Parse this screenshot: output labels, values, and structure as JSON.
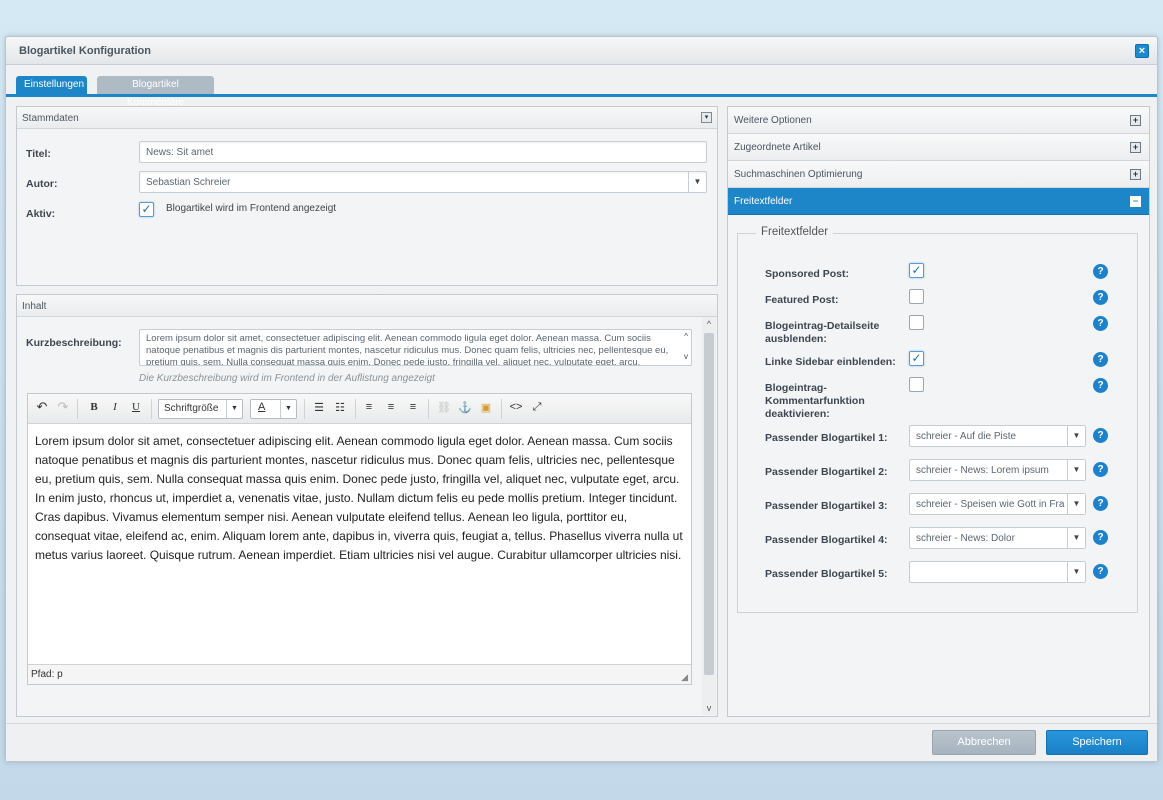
{
  "window": {
    "title": "Blogartikel Konfiguration",
    "close_icon": "×"
  },
  "tabs": [
    {
      "label": "Einstellungen",
      "active": true
    },
    {
      "label": "Blogartikel Kommentare",
      "active": false
    }
  ],
  "stammdaten": {
    "title": "Stammdaten",
    "titel_label": "Titel:",
    "titel_value": "News: Sit amet",
    "autor_label": "Autor:",
    "autor_value": "Sebastian Schreier",
    "aktiv_label": "Aktiv:",
    "aktiv_checked": true,
    "aktiv_text": "Blogartikel wird im Frontend angezeigt"
  },
  "inhalt": {
    "title": "Inhalt",
    "kurz_label": "Kurzbeschreibung:",
    "kurz_value": "Lorem ipsum dolor sit amet, consectetuer adipiscing elit. Aenean commodo ligula eget dolor. Aenean massa. Cum sociis natoque penatibus et magnis dis parturient montes, nascetur ridiculus mus. Donec quam felis, ultricies nec, pellentesque eu, pretium quis, sem. Nulla consequat massa quis enim. Donec pede justo, fringilla vel, aliquet nec, vulputate eget, arcu.",
    "kurz_hint": "Die Kurzbeschreibung wird im Frontend in der Auflistung angezeigt",
    "editor": {
      "fontsize_label": "Schriftgröße",
      "color_label": "A",
      "body": "Lorem ipsum dolor sit amet, consectetuer adipiscing elit. Aenean commodo ligula eget dolor. Aenean massa. Cum sociis natoque penatibus et magnis dis parturient montes, nascetur ridiculus mus. Donec quam felis, ultricies nec, pellentesque eu, pretium quis, sem. Nulla consequat massa quis enim. Donec pede justo, fringilla vel, aliquet nec, vulputate eget, arcu. In enim justo, rhoncus ut, imperdiet a, venenatis vitae, justo. Nullam dictum felis eu pede mollis pretium. Integer tincidunt. Cras dapibus. Vivamus elementum semper nisi. Aenean vulputate eleifend tellus. Aenean leo ligula, porttitor eu, consequat vitae, eleifend ac, enim. Aliquam lorem ante, dapibus in, viverra quis, feugiat a, tellus. Phasellus viverra nulla ut metus varius laoreet. Quisque rutrum. Aenean imperdiet. Etiam ultricies nisi vel augue. Curabitur ullamcorper ultricies nisi.",
      "path_label": "Pfad:",
      "path_value": "p"
    }
  },
  "accordion": [
    {
      "label": "Weitere Optionen",
      "active": false
    },
    {
      "label": "Zugeordnete Artikel",
      "active": false
    },
    {
      "label": "Suchmaschinen Optimierung",
      "active": false
    },
    {
      "label": "Freitextfelder",
      "active": true
    }
  ],
  "freitext": {
    "legend": "Freitextfelder",
    "checkboxes": [
      {
        "label": "Sponsored Post:",
        "checked": true
      },
      {
        "label": "Featured Post:",
        "checked": false
      },
      {
        "label": "Blogeintrag-Detailseite ausblenden:",
        "checked": false
      },
      {
        "label": "Linke Sidebar einblenden:",
        "checked": true
      },
      {
        "label": "Blogeintrag-Kommentarfunktion deaktivieren:",
        "checked": false
      }
    ],
    "selects": [
      {
        "label": "Passender Blogartikel 1:",
        "value": "schreier - Auf die Piste"
      },
      {
        "label": "Passender Blogartikel 2:",
        "value": "schreier - News: Lorem ipsum"
      },
      {
        "label": "Passender Blogartikel 3:",
        "value": "schreier - Speisen wie Gott in Fra"
      },
      {
        "label": "Passender Blogartikel 4:",
        "value": "schreier - News: Dolor"
      },
      {
        "label": "Passender Blogartikel 5:",
        "value": ""
      }
    ],
    "help_icon": "?"
  },
  "footer": {
    "cancel": "Abbrechen",
    "save": "Speichern"
  }
}
